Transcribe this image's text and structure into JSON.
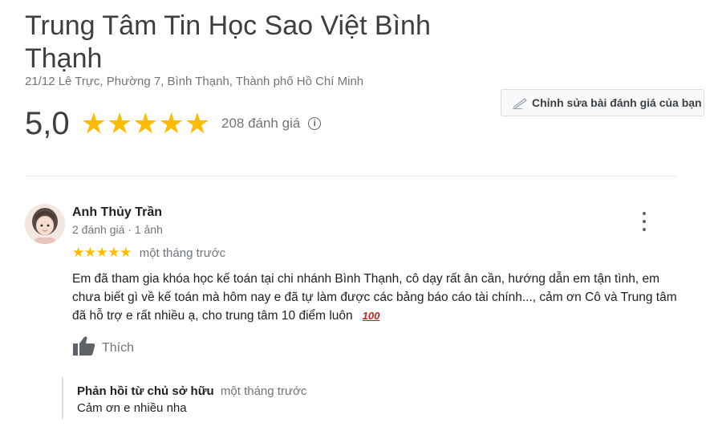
{
  "place": {
    "name": "Trung Tâm Tin Học Sao Việt Bình Thạnh",
    "address": "21/12 Lê Trực, Phường 7, Bình Thạnh, Thành phố Hồ Chí Minh",
    "rating_value": "5,0",
    "rating_stars": 5,
    "stars_display": "★★★★★",
    "review_count": "208 đánh giá"
  },
  "actions": {
    "edit_review_label": "Chỉnh sửa bài đánh giá của bạn",
    "edit_icon": "pencil-icon"
  },
  "review": {
    "author": "Anh Thủy Trần",
    "meta": "2 đánh giá · 1 ảnh",
    "stars": 5,
    "stars_display": "★★★★★",
    "time": "một tháng trước",
    "text": "Em đã tham gia khóa học kế toán tại chi nhánh Bình Thạnh, cô dạy rất ân cần, hướng dẫn em tận tình, em chưa biết gì về kế toán  mà hôm nay e đã tự làm được các bảng báo cáo tài chính..., cảm ơn Cô và Trung tâm đã hỗ trợ e rất nhiều ạ, cho trung tâm 10 điểm luôn",
    "emoji": "100",
    "like_label": "Thích"
  },
  "owner_reply": {
    "label": "Phản hồi từ chủ sở hữu",
    "time": "một tháng trước",
    "text": "Cảm ơn e nhiều nha"
  },
  "colors": {
    "star": "#fbbc04",
    "muted_text": "#70757a",
    "title_text": "#3c4043"
  }
}
